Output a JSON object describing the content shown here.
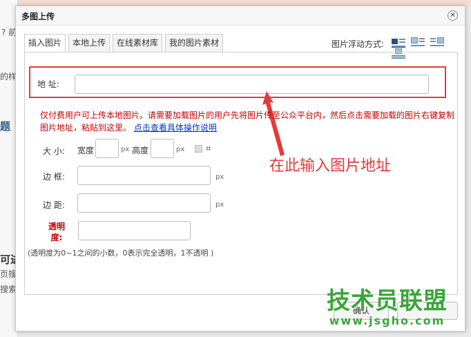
{
  "background": {
    "left_fragments": [
      "? 前",
      "的样",
      "题",
      "可进",
      "页搜",
      "搜索"
    ]
  },
  "dialog": {
    "title": "多图上传",
    "close_glyph": "✕",
    "tabs": [
      {
        "label": "插入图片",
        "active": true
      },
      {
        "label": "本地上传",
        "active": false
      },
      {
        "label": "在线素材库",
        "active": false
      },
      {
        "label": "我的图片素材",
        "active": false
      }
    ],
    "float_label": "图片浮动方式:",
    "float_icons": [
      "float-none-icon",
      "float-left-icon",
      "float-right-icon",
      "float-center-icon"
    ],
    "url_label": "地 址:",
    "warning_text": "仅付费用户可上传本地图片。请需要加载图片的用户先将图片传至公众平台内，然后点击需要加载的图片右键复制图片地址，粘贴到这里。",
    "warning_link": "点击查看具体操作说明",
    "size_label": "大 小:",
    "width_label": "宽度",
    "height_label": "高度",
    "unit_px": "px",
    "border_label": "边 框:",
    "margin_label": "边 距:",
    "opacity_label": "透明度:",
    "note": "(透明度为0~1之间的小数，0表示完全透明，1不透明 )",
    "annotation": "在此输入图片地址",
    "ok_label": "确认"
  },
  "watermark": {
    "title": "技术员联盟",
    "url": "www.jsgho.com"
  },
  "colors": {
    "annotation_red": "#e53a3a",
    "warning_red": "#c00000",
    "link_blue": "#0033cc",
    "watermark_green": "#3aa63a"
  }
}
